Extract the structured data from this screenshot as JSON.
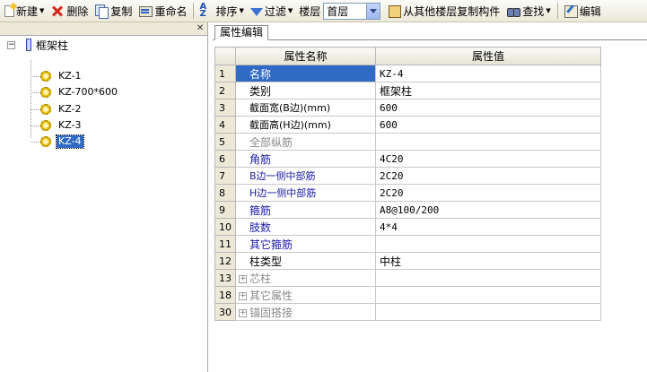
{
  "toolbar": {
    "new": "新建",
    "delete": "删除",
    "copy": "复制",
    "rename": "重命名",
    "sort": "排序",
    "filter": "过滤",
    "floor_label": "楼层",
    "floor_value": "首层",
    "copy_from_floor": "从其他楼层复制构件",
    "find": "查找",
    "edit": "编辑"
  },
  "tree": {
    "root": "框架柱",
    "items": [
      "KZ-1",
      "KZ-700*600",
      "KZ-2",
      "KZ-3",
      "KZ-4"
    ],
    "selected": "KZ-4"
  },
  "tabs": {
    "attr_edit": "属性编辑"
  },
  "table": {
    "headers": {
      "name": "属性名称",
      "value": "属性值"
    },
    "rows": [
      {
        "num": "1",
        "name": "名称",
        "value": "KZ-4"
      },
      {
        "num": "2",
        "name": "类别",
        "value": "框架柱"
      },
      {
        "num": "3",
        "name": "截面宽(B边)(mm)",
        "value": "600"
      },
      {
        "num": "4",
        "name": "截面高(H边)(mm)",
        "value": "600"
      },
      {
        "num": "5",
        "name": "全部纵筋",
        "value": ""
      },
      {
        "num": "6",
        "name": "角筋",
        "value": "4C20"
      },
      {
        "num": "7",
        "name": "B边一侧中部筋",
        "value": "2C20"
      },
      {
        "num": "8",
        "name": "H边一侧中部筋",
        "value": "2C20"
      },
      {
        "num": "9",
        "name": "箍筋",
        "value": "A8@100/200"
      },
      {
        "num": "10",
        "name": "肢数",
        "value": "4*4"
      },
      {
        "num": "11",
        "name": "其它箍筋",
        "value": ""
      },
      {
        "num": "12",
        "name": "柱类型",
        "value": "中柱"
      },
      {
        "num": "13",
        "name": "芯柱",
        "value": ""
      },
      {
        "num": "18",
        "name": "其它属性",
        "value": ""
      },
      {
        "num": "30",
        "name": "锚固搭接",
        "value": ""
      }
    ]
  },
  "icons": {
    "close": "close-icon",
    "expander": "tree-collapse-icon",
    "group": "group-expand-icon"
  }
}
